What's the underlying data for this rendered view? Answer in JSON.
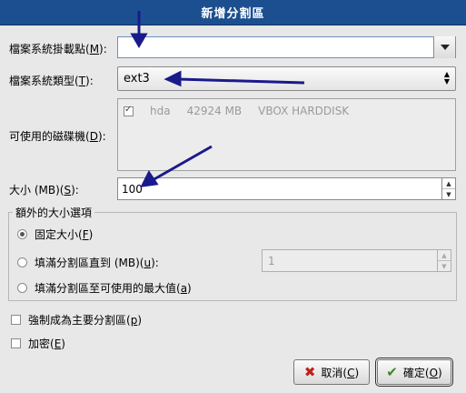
{
  "window": {
    "title": "新增分割區"
  },
  "form": {
    "mount_label": "檔案系統掛載點(",
    "mount_key": "M",
    "fstype_label": "檔案系統類型(",
    "fstype_key": "T",
    "fstype_value": "ext3",
    "drives_label": "可使用的磁碟機(",
    "drives_key": "D",
    "drive": {
      "name": "hda",
      "size": "42924 MB",
      "model": "VBOX HARDDISK"
    },
    "size_label": "大小 (MB)(",
    "size_key": "S",
    "size_value": "100"
  },
  "options": {
    "title": "額外的大小選項",
    "fixed_label": "固定大小(",
    "fixed_key": "F",
    "fill_upto_label": "填滿分割區直到 (MB)(",
    "fill_upto_key": "u",
    "fill_upto_value": "1",
    "fill_max_label": "填滿分割區至可使用的最大值(",
    "fill_max_key": "a"
  },
  "extra": {
    "primary_label": "強制成為主要分割區(",
    "primary_key": "p",
    "encrypt_label": "加密(",
    "encrypt_key": "E"
  },
  "buttons": {
    "cancel_label": "取消(",
    "cancel_key": "C",
    "ok_label": "確定(",
    "ok_key": "O"
  },
  "icons": {
    "cancel": "x-icon",
    "ok": "check-icon",
    "annotation": "arrow-icon"
  }
}
